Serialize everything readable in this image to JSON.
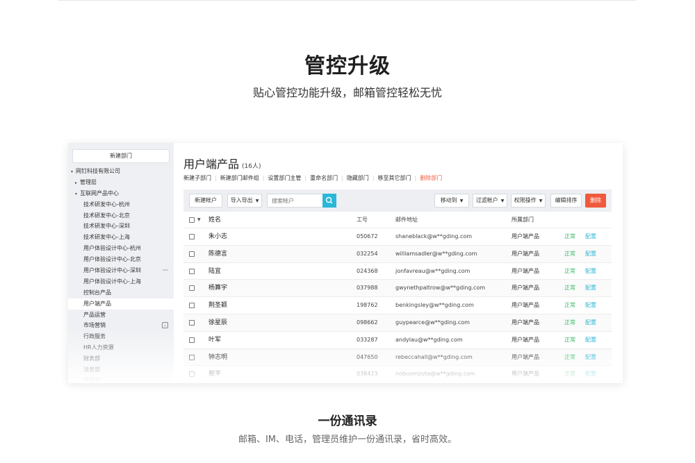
{
  "hero": {
    "title": "管控升级",
    "subtitle": "贴心管控功能升级，邮箱管控轻松无忧"
  },
  "sidebar": {
    "new_dept_label": "新建部门",
    "items": [
      {
        "label": "网钉科技有限公司",
        "indent": 0,
        "arrow": "▾"
      },
      {
        "label": "管理层",
        "indent": 1,
        "arrow": "▸"
      },
      {
        "label": "互联网产品中心",
        "indent": 1,
        "arrow": "▾"
      },
      {
        "label": "技术研发中心-杭州",
        "indent": 2,
        "arrow": ""
      },
      {
        "label": "技术研发中心-北京",
        "indent": 2,
        "arrow": ""
      },
      {
        "label": "技术研发中心-深圳",
        "indent": 2,
        "arrow": ""
      },
      {
        "label": "技术研发中心-上海",
        "indent": 2,
        "arrow": ""
      },
      {
        "label": "用户体验设计中心-杭州",
        "indent": 2,
        "arrow": ""
      },
      {
        "label": "用户体验设计中心-北京",
        "indent": 2,
        "arrow": ""
      },
      {
        "label": "用户体验设计中心-深圳",
        "indent": 2,
        "arrow": "",
        "extra": "wave"
      },
      {
        "label": "用户体验设计中心-上海",
        "indent": 2,
        "arrow": ""
      },
      {
        "label": "控制台产品",
        "indent": 2,
        "arrow": ""
      },
      {
        "label": "用户端产品",
        "indent": 2,
        "arrow": "",
        "selected": true
      },
      {
        "label": "产品运营",
        "indent": 2,
        "arrow": ""
      },
      {
        "label": "市场营销",
        "indent": 2,
        "arrow": "",
        "extra": "chevron"
      },
      {
        "label": "行政服务",
        "indent": 2,
        "arrow": ""
      },
      {
        "label": "HR人力资源",
        "indent": 2,
        "arrow": ""
      },
      {
        "label": "财务部",
        "indent": 2,
        "arrow": ""
      },
      {
        "label": "法务部",
        "indent": 2,
        "arrow": ""
      },
      {
        "label": "采购部",
        "indent": 2,
        "arrow": ""
      }
    ]
  },
  "main": {
    "title": "用户端产品",
    "count": "(16人)",
    "links": [
      "新建子部门",
      "新建部门邮件组",
      "设置部门主管",
      "重命名部门",
      "隐藏部门",
      "移至其它部门"
    ],
    "delete_link": "删除部门"
  },
  "toolbar": {
    "new_account": "新建帐户",
    "import_export": "导入导出",
    "search_placeholder": "搜索帐户",
    "move_to": "移动到",
    "filter_account": "过滤帐户",
    "permission": "权限操作",
    "edit_sort": "编辑排序",
    "delete": "删除"
  },
  "table": {
    "headers": {
      "name": "姓名",
      "id": "工号",
      "email": "邮件地址",
      "dept": "所属部门"
    },
    "rows": [
      {
        "name": "朱小志",
        "id": "050672",
        "email": "shaneblack@w**gding.com",
        "dept": "用户端产品",
        "status": "正常",
        "action": "配置"
      },
      {
        "name": "陈德言",
        "id": "032254",
        "email": "williamsadler@w**gding.com",
        "dept": "用户端产品",
        "status": "正常",
        "action": "配置"
      },
      {
        "name": "陆宜",
        "id": "024368",
        "email": "jonfavreau@w**gding.com",
        "dept": "用户端产品",
        "status": "正常",
        "action": "配置"
      },
      {
        "name": "杨算宇",
        "id": "037988",
        "email": "gwynethpaltrow@w**gding.com",
        "dept": "用户端产品",
        "status": "正常",
        "action": "配置"
      },
      {
        "name": "荆圣颖",
        "id": "198762",
        "email": "benkingsley@w**gding.com",
        "dept": "用户端产品",
        "status": "正常",
        "action": "配置"
      },
      {
        "name": "徐星辰",
        "id": "098662",
        "email": "guypearce@w**gding.com",
        "dept": "用户端产品",
        "status": "正常",
        "action": "配置"
      },
      {
        "name": "叶军",
        "id": "033287",
        "email": "andylau@w**gding.com",
        "dept": "用户端产品",
        "status": "正常",
        "action": "配置"
      },
      {
        "name": "钟志明",
        "id": "047650",
        "email": "rebeccahall@w**gding.com",
        "dept": "用户端产品",
        "status": "正常",
        "action": "配置"
      },
      {
        "name": "祝平",
        "id": "038423",
        "email": "nobuomzuta@w**gding.com",
        "dept": "用户端产品",
        "status": "正常",
        "action": "配置"
      }
    ]
  },
  "bottom": {
    "title": "一份通讯录",
    "subtitle": "邮箱、IM、电话，管理员维护一份通讯录，省时高效。"
  }
}
